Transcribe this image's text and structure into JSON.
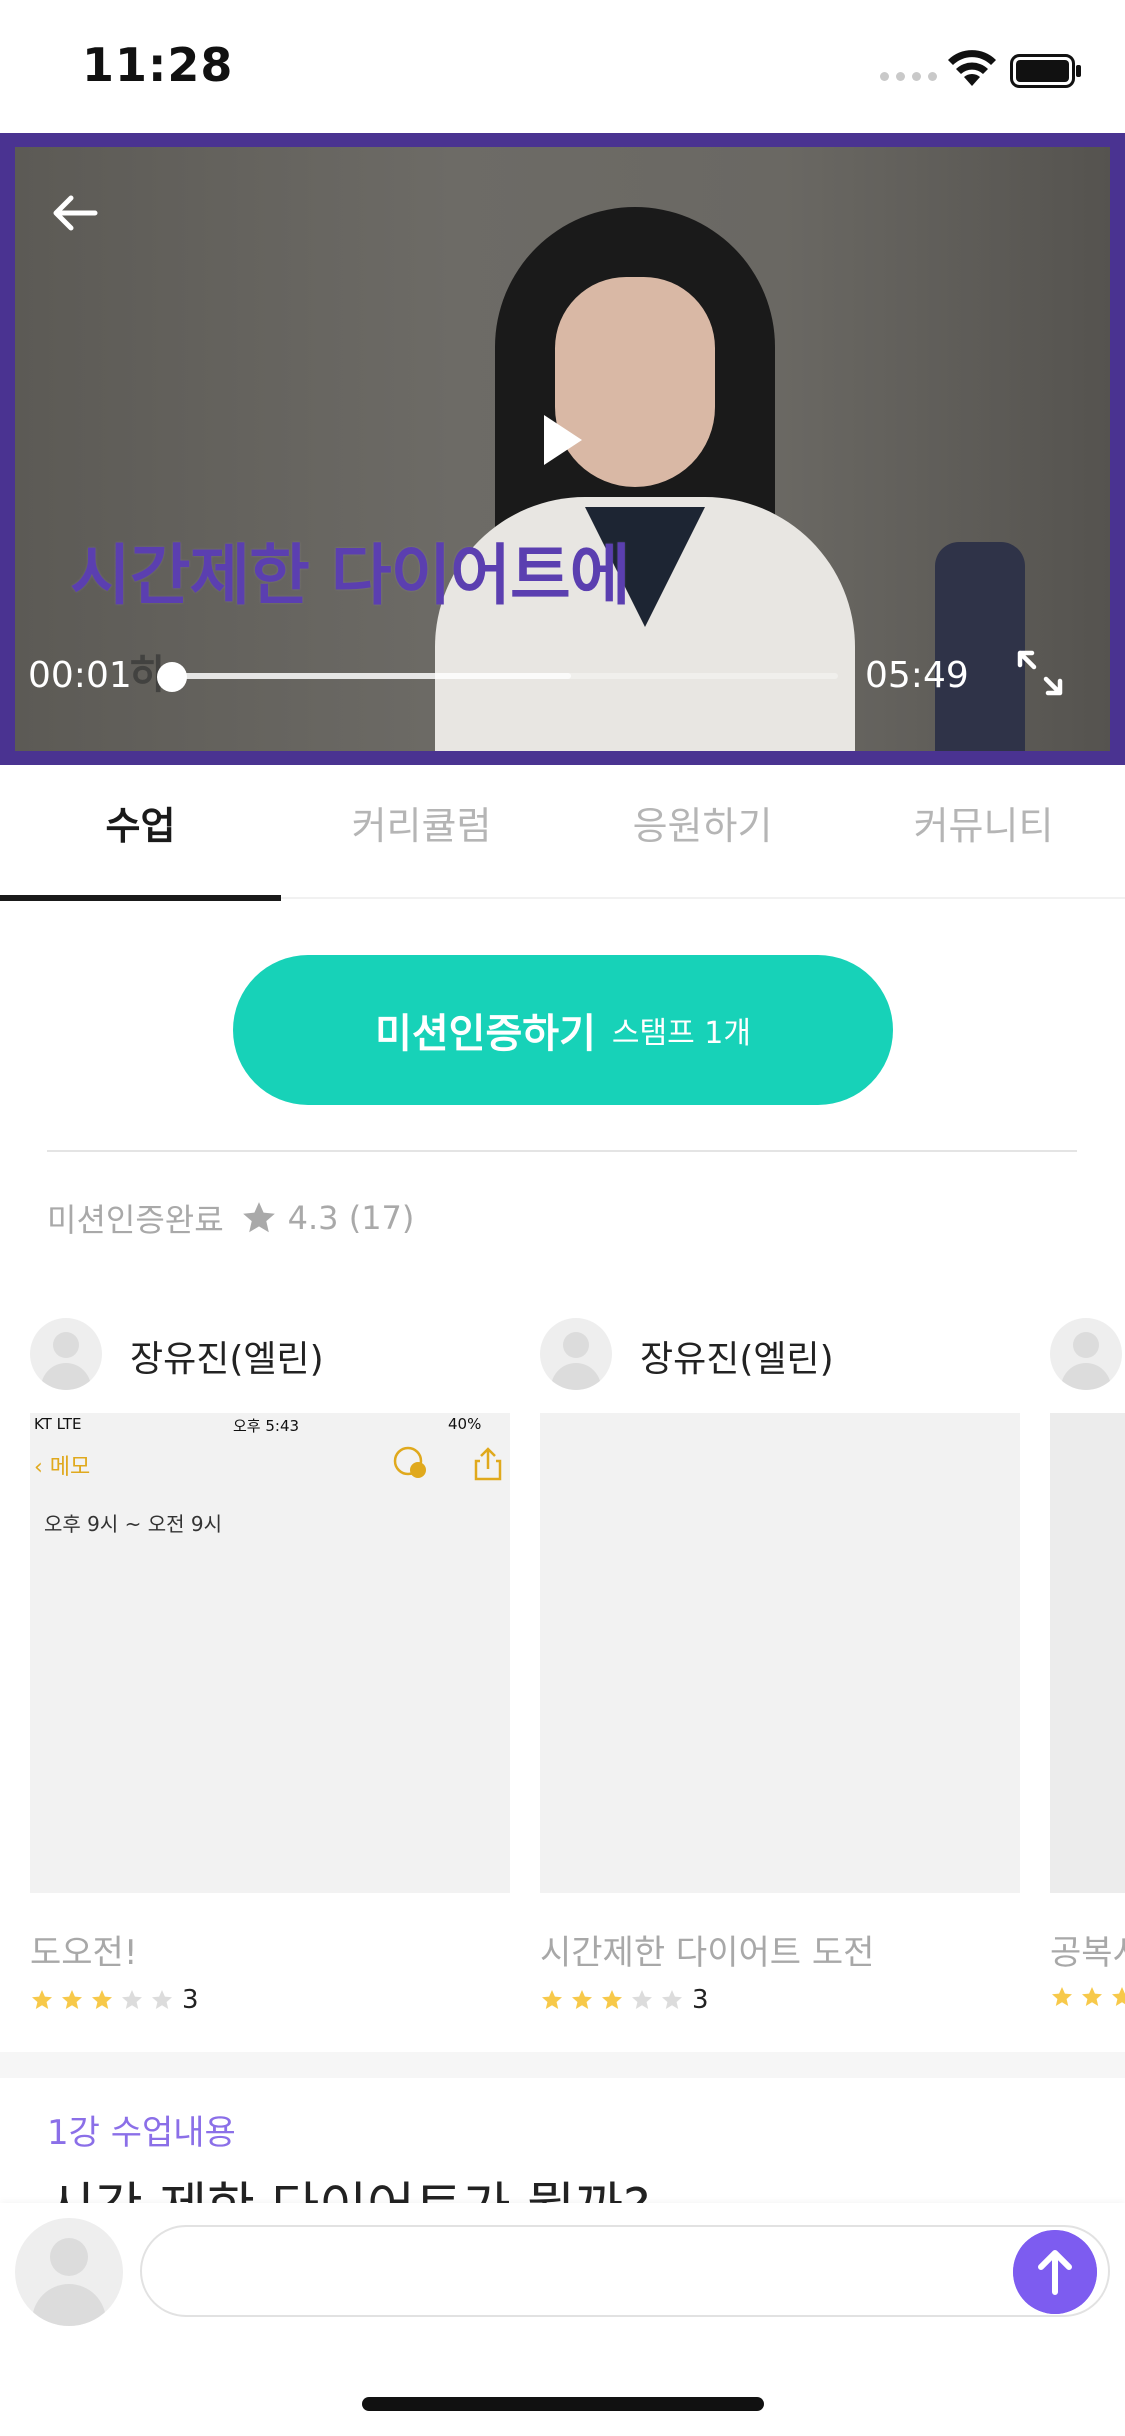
{
  "status_bar": {
    "time": "11:28"
  },
  "video": {
    "caption": "시간제한 다이어트에",
    "caption_sub": "하",
    "current_time": "00:01",
    "total_time": "05:49",
    "buffered_fraction": 0.6,
    "played_fraction": 0.003
  },
  "tabs": [
    {
      "label": "수업",
      "active": true
    },
    {
      "label": "커리큘럼",
      "active": false
    },
    {
      "label": "응원하기",
      "active": false
    },
    {
      "label": "커뮤니티",
      "active": false
    }
  ],
  "mission": {
    "label": "미션인증하기",
    "stamp": "스탬프 1개"
  },
  "rating": {
    "label": "미션인증완료",
    "value": "4.3 (17)"
  },
  "cards": [
    {
      "user": "장유진(엘린)",
      "title": "도오전!",
      "stars": 3,
      "score": "3",
      "memo": {
        "carrier": "KT  LTE",
        "clock": "오후 5:43",
        "battery": "40%",
        "back": "메모",
        "text": "오후 9시 ~ 오전 9시"
      }
    },
    {
      "user": "장유진(엘린)",
      "title": "시간제한 다이어트 도전",
      "stars": 3,
      "score": "3"
    },
    {
      "user": "",
      "title": "공복시",
      "stars": 3,
      "score": ""
    }
  ],
  "lesson": {
    "label": "1강 수업내용",
    "title": "시간 제한 다이어트가 뭘까?"
  },
  "comment": {
    "placeholder": ""
  },
  "colors": {
    "accent_teal": "#17d2b8",
    "accent_purple": "#7d5cf0",
    "video_frame": "#4a3391",
    "star": "#f7c94a"
  }
}
